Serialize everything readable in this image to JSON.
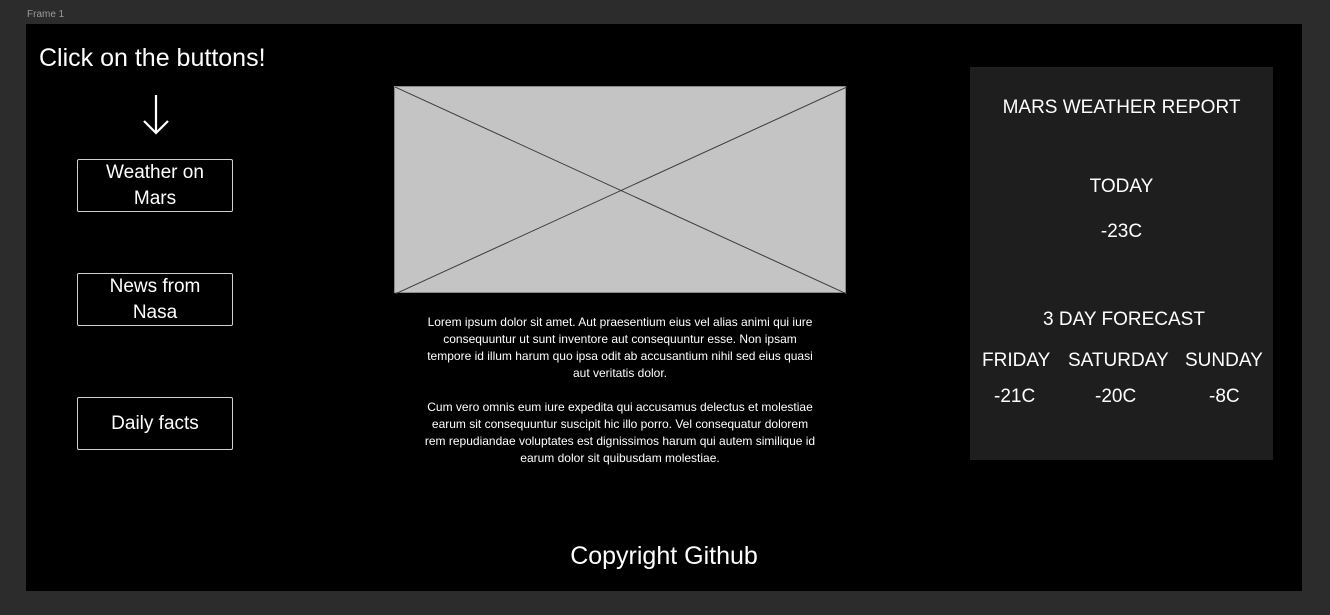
{
  "canvas": {
    "frame_label": "Frame 1"
  },
  "header": {
    "headline": "Click on the buttons!",
    "arrow_icon": "arrow-down-icon"
  },
  "nav": {
    "buttons": [
      {
        "label": "Weather on Mars"
      },
      {
        "label": "News from Nasa"
      },
      {
        "label": "Daily facts"
      }
    ]
  },
  "main": {
    "image_placeholder": "image-placeholder-icon",
    "paragraphs": [
      "Lorem ipsum dolor sit amet. Aut praesentium eius vel alias animi qui iure consequuntur ut sunt inventore aut consequuntur esse. Non ipsam tempore id illum harum quo ipsa odit ab accusantium nihil sed eius quasi aut veritatis dolor.",
      "Cum vero omnis eum iure expedita qui accusamus delectus et molestiae earum sit consequuntur suscipit hic illo porro. Vel consequatur dolorem rem repudiandae voluptates est dignissimos harum qui autem similique id earum dolor sit quibusdam molestiae."
    ]
  },
  "weather": {
    "title": "MARS WEATHER REPORT",
    "today_label": "TODAY",
    "today_temp": "-23C",
    "forecast_title": "3 DAY FORECAST",
    "forecast": [
      {
        "day": "FRIDAY",
        "temp": "-21C"
      },
      {
        "day": "SATURDAY",
        "temp": "-20C"
      },
      {
        "day": "SUNDAY",
        "temp": "-8C"
      }
    ]
  },
  "footer": {
    "copyright": "Copyright Github"
  },
  "colors": {
    "canvas_bg": "#2c2c2c",
    "frame_bg": "#000000",
    "panel_bg": "#1e1e1e",
    "placeholder_bg": "#c4c4c4",
    "text": "#ffffff"
  }
}
